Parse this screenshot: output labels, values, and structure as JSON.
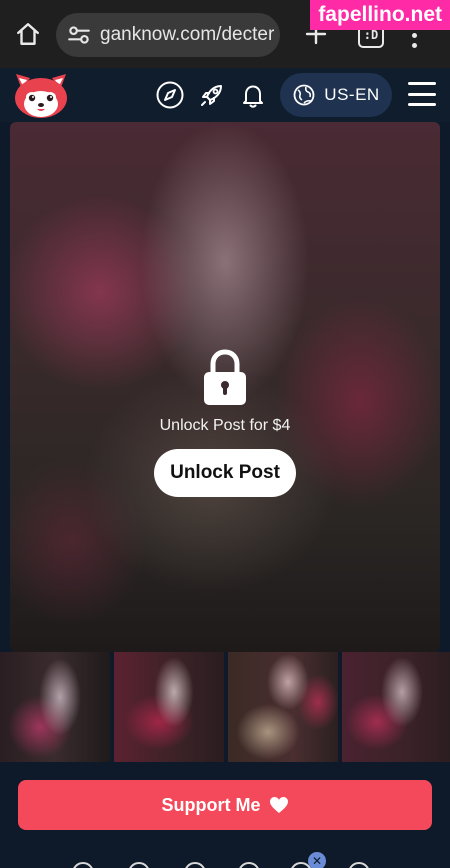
{
  "browser": {
    "url": "ganknow.com/decter",
    "tab_count": ":D",
    "icons": [
      "home-icon",
      "site-settings-icon",
      "plus-icon",
      "tab-switcher-icon",
      "more-vertical-icon"
    ]
  },
  "watermark": {
    "text": "fapellino.net"
  },
  "header": {
    "logo_alt": "red panda logo",
    "icons": [
      "compass-icon",
      "rocket-icon",
      "bell-icon",
      "globe-icon",
      "menu-icon"
    ],
    "language": "US-EN"
  },
  "post": {
    "unlock_text": "Unlock Post for $4",
    "unlock_button": "Unlock Post",
    "thumbnails_count": 4
  },
  "support": {
    "label": "Support Me",
    "icon": "heart-icon"
  },
  "colors": {
    "page_bg": "#0e1a29",
    "browser_bg": "#1f1f1f",
    "lang_pill": "#1f3350",
    "support_button": "#f4495a",
    "watermark": "#ff2aa6"
  }
}
